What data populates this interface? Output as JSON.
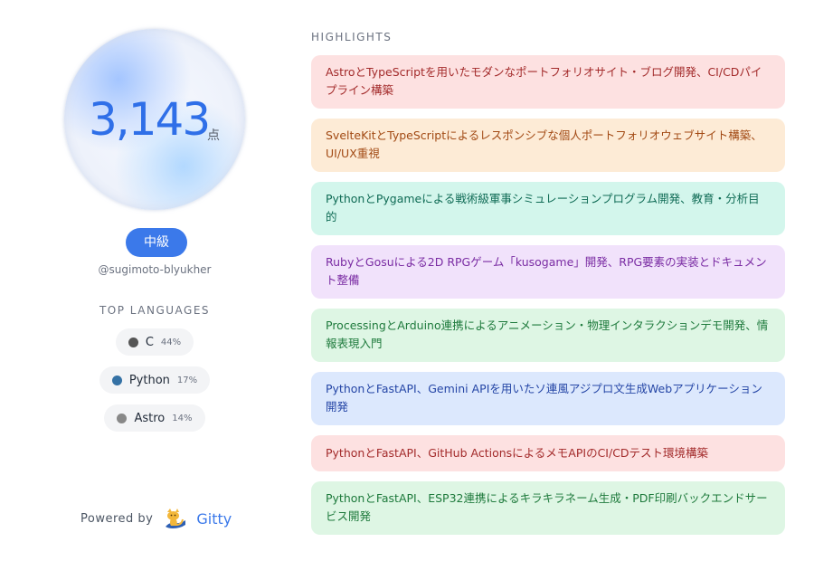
{
  "profile": {
    "score": "3,143",
    "score_unit": "点",
    "level": "中級",
    "username": "@sugimoto-blyukher"
  },
  "languages": {
    "title": "TOP LANGUAGES",
    "items": [
      {
        "name": "C",
        "percent": "44%",
        "color": "#555555"
      },
      {
        "name": "Python",
        "percent": "17%",
        "color": "#3572A5"
      },
      {
        "name": "Astro",
        "percent": "14%",
        "color": "#888888"
      }
    ]
  },
  "footer": {
    "powered_label": "Powered by",
    "brand": "Gitty"
  },
  "highlights": {
    "title": "HIGHLIGHTS",
    "items": [
      {
        "text": "AstroとTypeScriptを用いたモダンなポートフォリオサイト・ブログ開発、CI/CDパイプライン構築",
        "bg": "#fde1e1",
        "fg": "#a32b2b"
      },
      {
        "text": "SvelteKitとTypeScriptによるレスポンシブな個人ポートフォリオウェブサイト構築、UI/UX重視",
        "bg": "#fdebd6",
        "fg": "#a24a14"
      },
      {
        "text": "PythonとPygameによる戦術級軍事シミュレーションプログラム開発、教育・分析目的",
        "bg": "#d3f6ec",
        "fg": "#0f6b55"
      },
      {
        "text": "RubyとGosuによる2D RPGゲーム「kusogame」開発、RPG要素の実装とドキュメント整備",
        "bg": "#f1e2fb",
        "fg": "#7a2ca3"
      },
      {
        "text": "ProcessingとArduino連携によるアニメーション・物理インタラクションデモ開発、情報表現入門",
        "bg": "#def6e4",
        "fg": "#1e7a3c"
      },
      {
        "text": "PythonとFastAPI、Gemini APIを用いたソ連風アジプロ文生成Webアプリケーション開発",
        "bg": "#dce8fd",
        "fg": "#2546a6"
      },
      {
        "text": "PythonとFastAPI、GitHub ActionsによるメモAPIのCI/CDテスト環境構築",
        "bg": "#fde1e1",
        "fg": "#a32b2b"
      },
      {
        "text": "PythonとFastAPI、ESP32連携によるキラキラネーム生成・PDF印刷バックエンドサービス開発",
        "bg": "#def6e4",
        "fg": "#1e7a3c"
      }
    ]
  }
}
